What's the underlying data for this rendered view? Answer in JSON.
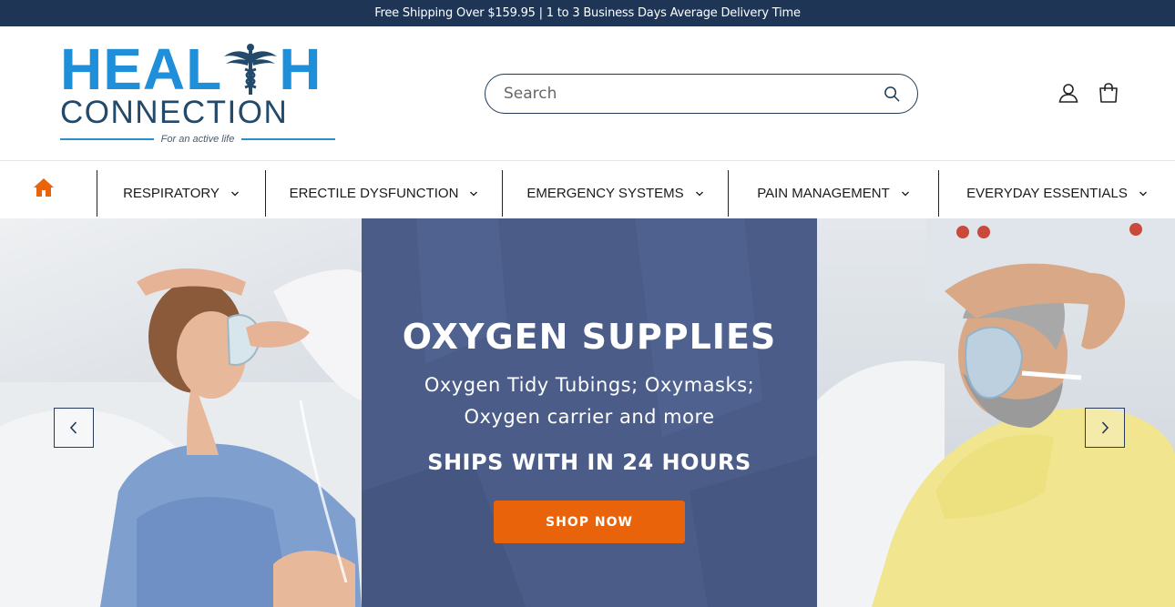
{
  "announcement": "Free Shipping Over $159.95 | 1 to 3 Business Days Average Delivery Time",
  "logo": {
    "line1_a": "HEAL",
    "line1_b": "H",
    "line2": "CONNECTION",
    "tagline": "For an active life"
  },
  "search": {
    "placeholder": "Search"
  },
  "nav": {
    "items": [
      {
        "label": "RESPIRATORY"
      },
      {
        "label": "ERECTILE DYSFUNCTION"
      },
      {
        "label": "EMERGENCY SYSTEMS"
      },
      {
        "label": "PAIN MANAGEMENT"
      },
      {
        "label": "EVERYDAY ESSENTIALS"
      }
    ]
  },
  "hero": {
    "title": "OXYGEN SUPPLIES",
    "subtitle": "Oxygen Tidy Tubings; Oxymasks; Oxygen carrier and more",
    "ship": "SHIPS WITH IN 24 HOURS",
    "cta": "SHOP NOW"
  },
  "colors": {
    "announce_bg": "#1e3556",
    "brand_blue": "#1e8fd8",
    "brand_navy": "#234a6a",
    "accent_orange": "#e8630a",
    "hero_panel": "#4a5c87"
  },
  "icons": [
    "home-icon",
    "search-icon",
    "account-icon",
    "cart-icon",
    "chevron-down-icon",
    "chevron-left-icon",
    "chevron-right-icon",
    "caduceus-icon"
  ]
}
